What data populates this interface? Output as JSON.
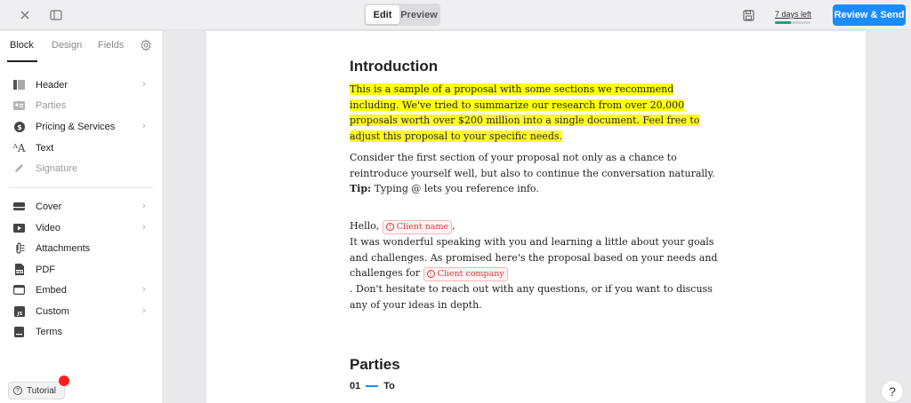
{
  "topbar": {
    "close_icon": "close-icon",
    "panel_icon": "sidebar-toggle-icon",
    "edit_label": "Edit",
    "preview_label": "Preview",
    "save_icon": "save-icon",
    "trial_label": "7 days left",
    "trial_progress": 0.45,
    "review_label": "Review & Send",
    "accent": "#1a8cff"
  },
  "sidebar": {
    "tabs": [
      {
        "label": "Block"
      },
      {
        "label": "Design"
      },
      {
        "label": "Fields"
      }
    ],
    "settings_icon": "gear-icon",
    "items": [
      {
        "label": "Header",
        "icon": "header-icon",
        "chevron": true,
        "disabled": false
      },
      {
        "label": "Parties",
        "icon": "parties-icon",
        "chevron": false,
        "disabled": true
      },
      {
        "label": "Pricing & Services",
        "icon": "dollar-icon",
        "chevron": true,
        "disabled": false
      },
      {
        "label": "Text",
        "icon": "text-icon",
        "chevron": false,
        "disabled": false
      },
      {
        "label": "Signature",
        "icon": "pen-icon",
        "chevron": false,
        "disabled": true
      },
      {
        "label": "Cover",
        "icon": "cover-icon",
        "chevron": true,
        "disabled": false
      },
      {
        "label": "Video",
        "icon": "play-icon",
        "chevron": true,
        "disabled": false
      },
      {
        "label": "Attachments",
        "icon": "attachment-icon",
        "chevron": false,
        "disabled": false
      },
      {
        "label": "PDF",
        "icon": "pdf-icon",
        "chevron": false,
        "disabled": false
      },
      {
        "label": "Embed",
        "icon": "embed-icon",
        "chevron": true,
        "disabled": false
      },
      {
        "label": "Custom",
        "icon": "js-icon",
        "chevron": true,
        "disabled": false
      },
      {
        "label": "Terms",
        "icon": "terms-icon",
        "chevron": false,
        "disabled": false
      }
    ],
    "tutorial_label": "Tutorial"
  },
  "document": {
    "title": "Introduction",
    "intro_highlight": "This is a sample of a proposal with some sections we recommend including. We've tried to summarize our research from over 20,000 proposals worth over $200 million into a single document. Feel free to adjust this proposal to your specific needs.",
    "para2": "Consider the first section of your proposal not only as a chance to reintroduce yourself well, but also to continue the conversation naturally.",
    "tip_label": "Tip:",
    "tip_text": " Typing @ lets you reference info.",
    "hello": "Hello, ",
    "client_name_chip": "Client name",
    "comma": ",",
    "para3a": "It was wonderful speaking with you and learning a little about your goals and challenges. As promised here's the proposal based on your needs and challenges for ",
    "client_company_chip": "Client company",
    "para3b": ". Don't hesitate to reach out with any questions, or if you want to discuss any of your ideas in depth.",
    "parties_title": "Parties",
    "parties_index": "01",
    "parties_to": "To"
  },
  "help_label": "?"
}
